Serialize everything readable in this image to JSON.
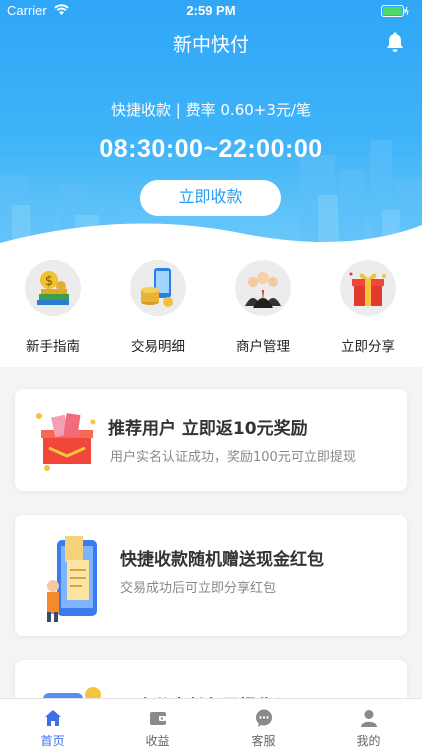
{
  "status_bar": {
    "carrier": "Carrier",
    "time": "2:59 PM"
  },
  "header": {
    "title": "新中快付",
    "fee_text": "快捷收款 | 费率 0.60+3元/笔",
    "hours": "08:30:00~22:00:00",
    "collect_button": "立即收款"
  },
  "menu": {
    "items": [
      {
        "label": "新手指南",
        "icon": "money-books-icon"
      },
      {
        "label": "交易明细",
        "icon": "phone-coins-icon"
      },
      {
        "label": "商户管理",
        "icon": "business-people-icon"
      },
      {
        "label": "立即分享",
        "icon": "gift-box-icon"
      }
    ]
  },
  "cards": [
    {
      "title": "推荐用户  立即返10元奖励",
      "subtitle": "用户实名认证成功，奖励100元可立即提现",
      "icon": "red-envelope-box-icon"
    },
    {
      "title": "快捷收款随机赠送现金红包",
      "subtitle": "交易成功后可立即分享红包",
      "icon": "phone-receipt-icon"
    },
    {
      "title": "一次分享长久回报收入",
      "subtitle": "",
      "icon": "card-icon"
    }
  ],
  "tabbar": {
    "tabs": [
      {
        "label": "首页",
        "icon": "home-icon",
        "active": true
      },
      {
        "label": "收益",
        "icon": "wallet-icon",
        "active": false
      },
      {
        "label": "客服",
        "icon": "chat-icon",
        "active": false
      },
      {
        "label": "我的",
        "icon": "user-icon",
        "active": false
      }
    ]
  },
  "colors": {
    "primary": "#2fa6f7",
    "active_tab": "#3d6fe8",
    "background": "#f3f4f6"
  }
}
